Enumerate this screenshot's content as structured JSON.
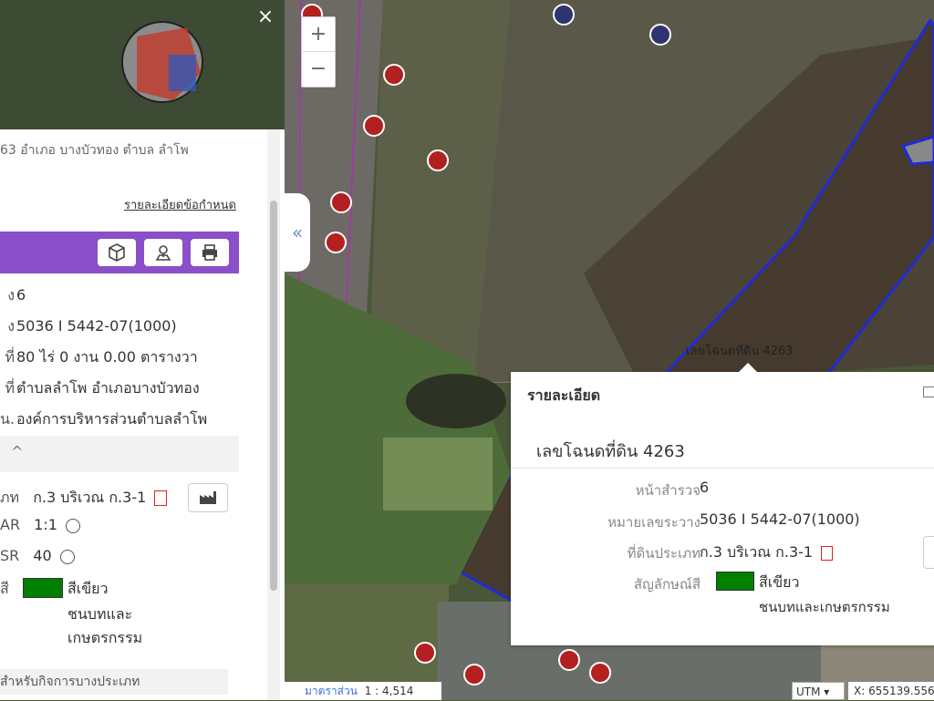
{
  "map": {
    "zoom_in": "+",
    "zoom_out": "−",
    "parcel_label": "เลขโฉนดที่ดิน 4263",
    "scale_label": "มาตราส่วน",
    "scale_value": "1 : 4,514",
    "crs": "UTM",
    "coord": "X: 655139.556",
    "thumb_close": "×",
    "collapse_icon": "«"
  },
  "panel": {
    "address": "63 อำเภอ บางบัวทอง ตำบล ลำโพ",
    "rules_link": "รายละเอียดข้อกำหนด",
    "rows": [
      {
        "label": "ง",
        "value": "6"
      },
      {
        "label": "ง",
        "value": "5036 I 5442-07(1000)"
      },
      {
        "label": "ที่",
        "value": "80 ไร่ 0 งาน 0.00 ตารางวา"
      },
      {
        "label": "ที่",
        "value": "ตำบลลำโพ อำเภอบางบัวทอง"
      },
      {
        "label": "น.",
        "value": "องค์การบริหารส่วนตำบลลำโพ"
      }
    ],
    "section_toggle": "^",
    "zoning": {
      "type_label": "ภท",
      "type_value": "ก.3 บริเวณ ก.3-1",
      "far_label": "AR",
      "far_value": "1:1",
      "osr_label": "SR",
      "osr_value": "40",
      "color_label": "สี",
      "color_name": "สีเขียว",
      "color_desc_1": "ชนบทและ",
      "color_desc_2": "เกษตรกรรม",
      "color_hex": "#008000"
    },
    "footer_text": "สำหรับกิจการบางประเภท"
  },
  "popup": {
    "title": "รายละเอียด",
    "heading": "เลขโฉนดที่ดิน 4263",
    "survey_page_label": "หน้าสำรวจ",
    "survey_page_value": "6",
    "map_sheet_label": "หมายเลขระวาง",
    "map_sheet_value": "5036 I 5442-07(1000)",
    "land_type_label": "ที่ดินประเภท",
    "land_type_value": "ก.3 บริเวณ ก.3-1",
    "color_label": "สัญลักษณ์สี",
    "color_name": "สีเขียว",
    "color_desc": "ชนบทและเกษตรกรรม",
    "color_hex": "#008000"
  }
}
